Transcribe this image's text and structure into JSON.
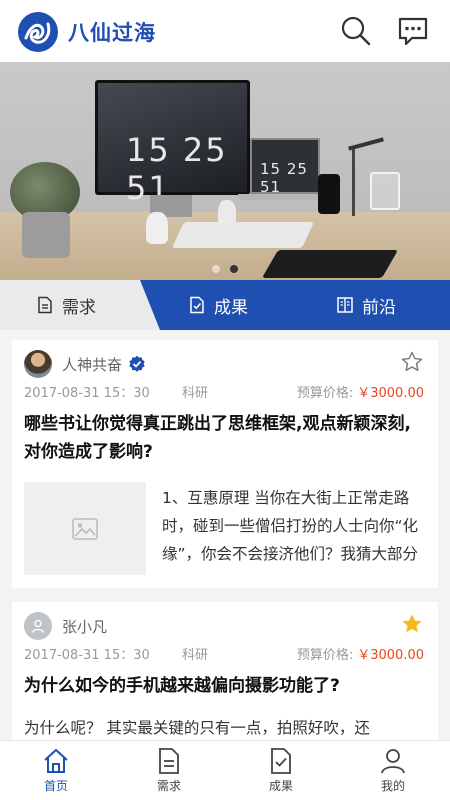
{
  "header": {
    "brand": "八仙过海",
    "search_icon": "search-icon",
    "message_icon": "chat-bubble-icon"
  },
  "banner": {
    "monitor_clock": "15 25 51",
    "laptop_clock": "15 25 51",
    "slide_count": 2,
    "active_slide": 1
  },
  "tabs": [
    {
      "label": "需求",
      "icon": "document-icon",
      "active": false
    },
    {
      "label": "成果",
      "icon": "document-check-icon",
      "active": true
    },
    {
      "label": "前沿",
      "icon": "book-icon",
      "active": false
    }
  ],
  "posts": [
    {
      "user": "人神共奋",
      "verified": true,
      "starred": false,
      "date": "2017-08-31 15：30",
      "category": "科研",
      "budget_label": "预算价格:",
      "price": "￥3000.00",
      "title": "哪些书让你觉得真正跳出了思维框架,观点新颖深刻,对你造成了影响?",
      "excerpt": "1、互惠原理 当你在大街上正常走路时，碰到一些僧侣打扮的人士向你“化缘”，你会不会接济他们？我猜大部分",
      "has_image_placeholder": true
    },
    {
      "user": "张小凡",
      "verified": false,
      "starred": true,
      "date": "2017-08-31 15：30",
      "category": "科研",
      "budget_label": "预算价格:",
      "price": "￥3000.00",
      "title": "为什么如今的手机越来越偏向摄影功能了?",
      "excerpt": "为什么呢？ 其实最关键的只有一点，拍照好吹，还"
    }
  ],
  "bottom_nav": [
    {
      "label": "首页",
      "icon": "home-icon",
      "active": true
    },
    {
      "label": "需求",
      "icon": "document-icon",
      "active": false
    },
    {
      "label": "成果",
      "icon": "document-check-icon",
      "active": false
    },
    {
      "label": "我的",
      "icon": "user-icon",
      "active": false
    }
  ],
  "colors": {
    "brand_blue": "#1f4fb0",
    "price_red": "#e8471c",
    "star_gold": "#f5b91c"
  }
}
